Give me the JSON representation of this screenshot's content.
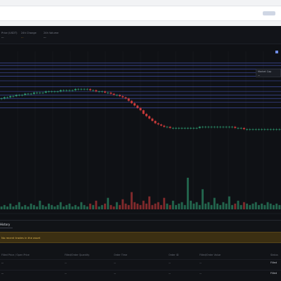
{
  "browser": {
    "url": ""
  },
  "stats": [
    {
      "label": "Price (USDT)",
      "value": "..."
    },
    {
      "label": "24h Change",
      "value": "...",
      "accent": "#e39a1d"
    },
    {
      "label": "24h Volume",
      "value": "..."
    }
  ],
  "chart": {
    "tooltip": {
      "label": "Market Cap",
      "value": "..."
    },
    "x_labels": [
      "",
      "",
      "",
      "",
      "",
      "",
      "",
      ""
    ],
    "x_right_label": "..."
  },
  "chart_data": {
    "type": "candlestick",
    "title": "",
    "xlabel": "",
    "ylabel": "",
    "ylim": [
      0,
      100
    ],
    "close": [
      60,
      61,
      61,
      62,
      62,
      63,
      63,
      63,
      64,
      64,
      64,
      65,
      65,
      65,
      65,
      66,
      66,
      66,
      66,
      66,
      67,
      67,
      67,
      67,
      67,
      68,
      68,
      68,
      68,
      68,
      67,
      67,
      66,
      66,
      66,
      65,
      65,
      64,
      63,
      63,
      62,
      61,
      60,
      58,
      56,
      54,
      52,
      50,
      47,
      45,
      43,
      41,
      39,
      38,
      37,
      36,
      36,
      35,
      35,
      35,
      35,
      35,
      35,
      35,
      35,
      35,
      35,
      36,
      36,
      36,
      36,
      36,
      36,
      36,
      36,
      36,
      36,
      36,
      36,
      35,
      35,
      35,
      34,
      34,
      34,
      34,
      34,
      34,
      34,
      34,
      34,
      34,
      34,
      34,
      34
    ],
    "volume": [
      2,
      3,
      2,
      4,
      2,
      3,
      5,
      2,
      3,
      2,
      4,
      3,
      2,
      6,
      3,
      2,
      4,
      3,
      2,
      3,
      5,
      2,
      3,
      4,
      2,
      3,
      2,
      5,
      3,
      2,
      4,
      3,
      6,
      2,
      3,
      4,
      8,
      3,
      2,
      5,
      3,
      7,
      4,
      3,
      12,
      5,
      4,
      3,
      6,
      4,
      9,
      3,
      4,
      5,
      3,
      8,
      4,
      3,
      6,
      3,
      4,
      5,
      3,
      22,
      6,
      4,
      5,
      3,
      14,
      4,
      5,
      3,
      8,
      4,
      3,
      5,
      4,
      9,
      3,
      4,
      6,
      3,
      5,
      4,
      3,
      4,
      5,
      3,
      4,
      3,
      5,
      4,
      3,
      4,
      3
    ],
    "levels": [
      52,
      57,
      60,
      63,
      66,
      70,
      75,
      79,
      82,
      85,
      88,
      90
    ]
  },
  "history": {
    "tab_label": "History",
    "alert_text": "No recent trades in the asset",
    "columns": [
      "Filled Price / Open Price",
      "Filled/Order Quantity",
      "Order Time",
      "Order ID",
      "Filled/Order Value",
      "Status"
    ],
    "rows": [
      [
        "...",
        "...",
        "...",
        "...",
        "...",
        "Filled"
      ],
      [
        "...",
        "...",
        "...",
        "...",
        "...",
        "Filled"
      ]
    ]
  },
  "colors": {
    "up": "#2e9d72",
    "down": "#c93a3a",
    "level": "#5363d6"
  }
}
